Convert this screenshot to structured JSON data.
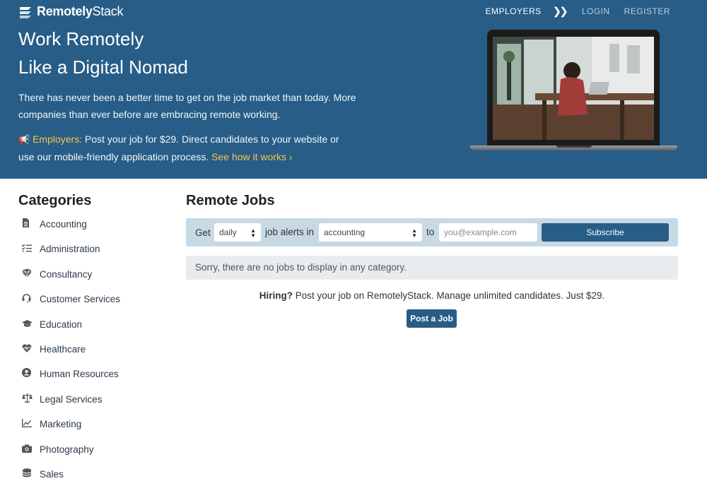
{
  "brand": {
    "name_bold": "Remotely",
    "name_light": "Stack"
  },
  "nav": {
    "employers": "EMPLOYERS",
    "chevron": "❯❯",
    "login": "LOGIN",
    "register": "REGISTER"
  },
  "hero": {
    "title_line1": "Work Remotely",
    "title_line2": "Like a Digital Nomad",
    "paragraph": "There has never been a better time to get on the job market than today. More companies than ever before are embracing remote working.",
    "employers_label": "Employers:",
    "employers_text": " Post your job for $29. Direct candidates to your website or use our mobile-friendly application process. ",
    "see_how_link": "See how it works ›"
  },
  "sidebar": {
    "title": "Categories",
    "items": [
      {
        "label": "Accounting",
        "icon": "document-icon"
      },
      {
        "label": "Administration",
        "icon": "checklist-icon"
      },
      {
        "label": "Consultancy",
        "icon": "diamond-icon"
      },
      {
        "label": "Customer Services",
        "icon": "headset-icon"
      },
      {
        "label": "Education",
        "icon": "graduation-cap-icon"
      },
      {
        "label": "Healthcare",
        "icon": "heartbeat-icon"
      },
      {
        "label": "Human Resources",
        "icon": "user-circle-icon"
      },
      {
        "label": "Legal Services",
        "icon": "balance-scale-icon"
      },
      {
        "label": "Marketing",
        "icon": "line-chart-icon"
      },
      {
        "label": "Photography",
        "icon": "camera-icon"
      },
      {
        "label": "Sales",
        "icon": "coins-icon"
      }
    ]
  },
  "main": {
    "title": "Remote Jobs",
    "alert": {
      "get_label": "Get",
      "frequency_value": "daily",
      "alerts_in_label": "job alerts in",
      "category_value": "accounting",
      "to_label": "to",
      "email_placeholder": "you@example.com",
      "subscribe_label": "Subscribe"
    },
    "no_jobs_message": "Sorry, there are no jobs to display in any category.",
    "hiring_bold": "Hiring?",
    "hiring_text": " Post your job on RemotelyStack. Manage unlimited candidates. Just $29.",
    "post_job_label": "Post a Job"
  },
  "colors": {
    "primary": "#275d86",
    "accent": "#f5c552",
    "alert_bar": "#c8d9e6",
    "notice_bg": "#e9ecef"
  }
}
